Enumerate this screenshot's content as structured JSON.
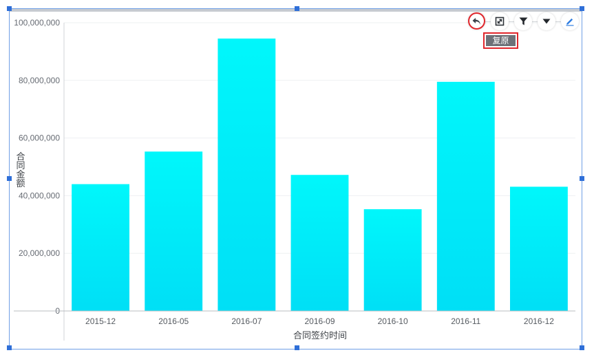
{
  "toolbar": {
    "restore_tooltip": "复原",
    "buttons": [
      {
        "id": "restore",
        "icon": "undo-arrow-icon"
      },
      {
        "id": "fullscreen",
        "icon": "expand-icon"
      },
      {
        "id": "filter",
        "icon": "filter-funnel-icon"
      },
      {
        "id": "more",
        "icon": "caret-down-icon"
      },
      {
        "id": "edit",
        "icon": "pencil-icon"
      }
    ]
  },
  "colors": {
    "bar_top": "#00f7fb",
    "bar_bottom": "#00dff6",
    "selection_border": "#6f9fe6",
    "handle": "#2f6fd8",
    "highlight": "#e0262c",
    "edit_icon": "#2f7de1"
  },
  "chart_data": {
    "type": "bar",
    "categories": [
      "2015-12",
      "2016-05",
      "2016-07",
      "2016-09",
      "2016-10",
      "2016-11",
      "2016-12"
    ],
    "values": [
      44000000,
      55300000,
      94500000,
      47200000,
      35300000,
      79500000,
      43100000
    ],
    "xlabel": "合同签约时间",
    "ylabel": "合同金额",
    "ylim": [
      0,
      100000000
    ],
    "yticks": [
      "0",
      "20,000,000",
      "40,000,000",
      "60,000,000",
      "80,000,000",
      "100,000,000"
    ],
    "ytick_values": [
      0,
      20000000,
      40000000,
      60000000,
      80000000,
      100000000
    ],
    "grid": true,
    "legend": "none"
  }
}
